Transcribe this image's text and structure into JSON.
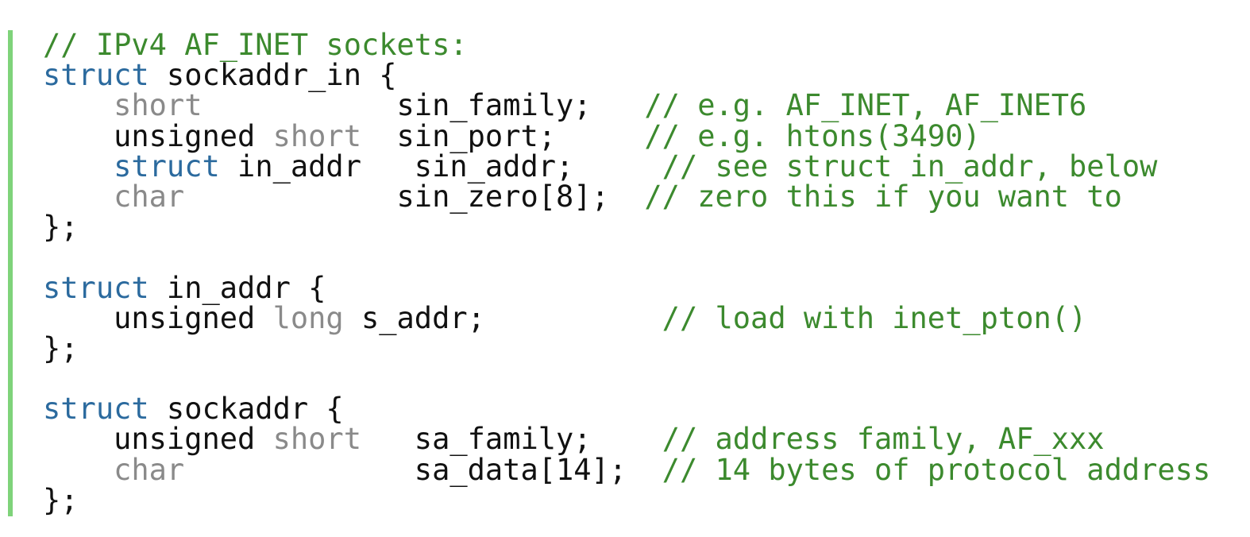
{
  "code_block": {
    "lines": [
      [
        {
          "t": "// IPv4 AF_INET sockets:",
          "k": "comment"
        }
      ],
      [
        {
          "t": "struct",
          "k": "keyword"
        },
        {
          "t": " sockaddr_in {",
          "k": "plain"
        }
      ],
      [
        {
          "t": "    ",
          "k": "plain"
        },
        {
          "t": "short",
          "k": "type"
        },
        {
          "t": "           sin_family;   ",
          "k": "plain"
        },
        {
          "t": "// e.g. AF_INET, AF_INET6",
          "k": "comment"
        }
      ],
      [
        {
          "t": "    unsigned ",
          "k": "plain"
        },
        {
          "t": "short",
          "k": "type"
        },
        {
          "t": "  sin_port;     ",
          "k": "plain"
        },
        {
          "t": "// e.g. htons(3490)",
          "k": "comment"
        }
      ],
      [
        {
          "t": "    ",
          "k": "plain"
        },
        {
          "t": "struct",
          "k": "keyword"
        },
        {
          "t": " in_addr   sin_addr;     ",
          "k": "plain"
        },
        {
          "t": "// see struct in_addr, below",
          "k": "comment"
        }
      ],
      [
        {
          "t": "    ",
          "k": "plain"
        },
        {
          "t": "char",
          "k": "type"
        },
        {
          "t": "            sin_zero[8];  ",
          "k": "plain"
        },
        {
          "t": "// zero this if you want to",
          "k": "comment"
        }
      ],
      [
        {
          "t": "};",
          "k": "plain"
        }
      ],
      [
        {
          "t": "",
          "k": "plain"
        }
      ],
      [
        {
          "t": "struct",
          "k": "keyword"
        },
        {
          "t": " in_addr {",
          "k": "plain"
        }
      ],
      [
        {
          "t": "    unsigned ",
          "k": "plain"
        },
        {
          "t": "long",
          "k": "type"
        },
        {
          "t": " s_addr;          ",
          "k": "plain"
        },
        {
          "t": "// load with inet_pton()",
          "k": "comment"
        }
      ],
      [
        {
          "t": "};",
          "k": "plain"
        }
      ],
      [
        {
          "t": "",
          "k": "plain"
        }
      ],
      [
        {
          "t": "struct",
          "k": "keyword"
        },
        {
          "t": " sockaddr {",
          "k": "plain"
        }
      ],
      [
        {
          "t": "    unsigned ",
          "k": "plain"
        },
        {
          "t": "short",
          "k": "type"
        },
        {
          "t": "   sa_family;    ",
          "k": "plain"
        },
        {
          "t": "// address family, AF_xxx",
          "k": "comment"
        }
      ],
      [
        {
          "t": "    ",
          "k": "plain"
        },
        {
          "t": "char",
          "k": "type"
        },
        {
          "t": "             sa_data[14];  ",
          "k": "plain"
        },
        {
          "t": "// 14 bytes of protocol address",
          "k": "comment"
        }
      ],
      [
        {
          "t": "};",
          "k": "plain"
        }
      ]
    ]
  },
  "colors": {
    "keyword": "#2b6a9e",
    "type": "#8a8a8a",
    "comment": "#3c8a2e",
    "plain": "#111111",
    "gutter": "#7fd37a",
    "background": "#ffffff"
  }
}
